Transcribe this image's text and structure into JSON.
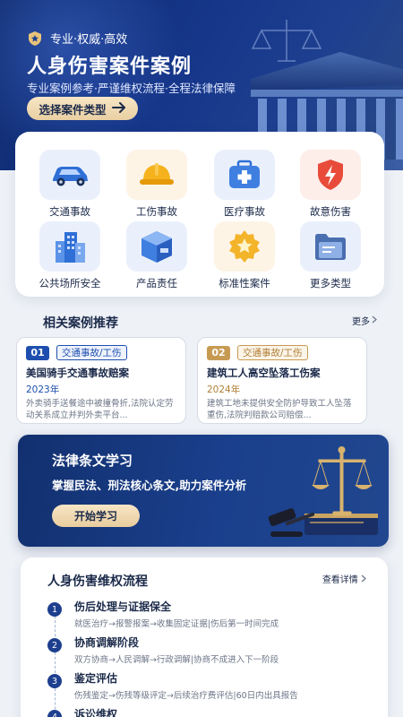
{
  "hero": {
    "tagline": "专业·权威·高效",
    "title": "人身伤害案件案例",
    "subtitle": "专业案例参考·严谨维权流程·全程法律保障",
    "button_label": "选择案件类型"
  },
  "categories": [
    {
      "label": "交通事故",
      "icon": "car-icon"
    },
    {
      "label": "工伤事故",
      "icon": "hard-hat-icon"
    },
    {
      "label": "医疗事故",
      "icon": "medical-kit-icon"
    },
    {
      "label": "故意伤害",
      "icon": "shield-lightning-icon"
    },
    {
      "label": "公共场所安全",
      "icon": "buildings-icon"
    },
    {
      "label": "产品责任",
      "icon": "product-box-icon"
    },
    {
      "label": "标准性案件",
      "icon": "star-badge-icon"
    },
    {
      "label": "更多类型",
      "icon": "folder-icon"
    }
  ],
  "related": {
    "title": "相关案例推荐",
    "more_label": "更多",
    "cases": [
      {
        "num": "01",
        "tag": "交通事故/工伤",
        "title": "美国骑手交通事故赔案",
        "year": "2023年",
        "desc": "外卖骑手送餐途中被撞骨折,法院认定劳动关系成立并判外卖平台..."
      },
      {
        "num": "02",
        "tag": "交通事故/工伤",
        "title": "建筑工人高空坠落工伤案",
        "year": "2024年",
        "desc": "建筑工地未提供安全防护导致工人坠落重伤,法院判赔款公司赔偿..."
      }
    ]
  },
  "law": {
    "title": "法律条文学习",
    "subtitle": "掌握民法、刑法核心条文,助力案件分析",
    "button_label": "开始学习"
  },
  "process": {
    "title": "人身伤害维权流程",
    "more_label": "查看详情",
    "steps": [
      {
        "num": "1",
        "title": "伤后处理与证据保全",
        "desc": "就医治疗→报警报案→收集固定证据|伤后第一时间完成"
      },
      {
        "num": "2",
        "title": "协商调解阶段",
        "desc": "双方协商→人民调解→行政调解|协商不成进入下一阶段"
      },
      {
        "num": "3",
        "title": "鉴定评估",
        "desc": "伤残鉴定→伤残等级评定→后续治疗费评估|60日内出具报告"
      },
      {
        "num": "4",
        "title": "诉讼维权",
        "desc": ""
      }
    ]
  },
  "colors": {
    "primary": "#1e3f8f",
    "gold": "#e9cfa2",
    "case1_accent": "#1e4fae",
    "case2_accent": "#c79a52"
  }
}
